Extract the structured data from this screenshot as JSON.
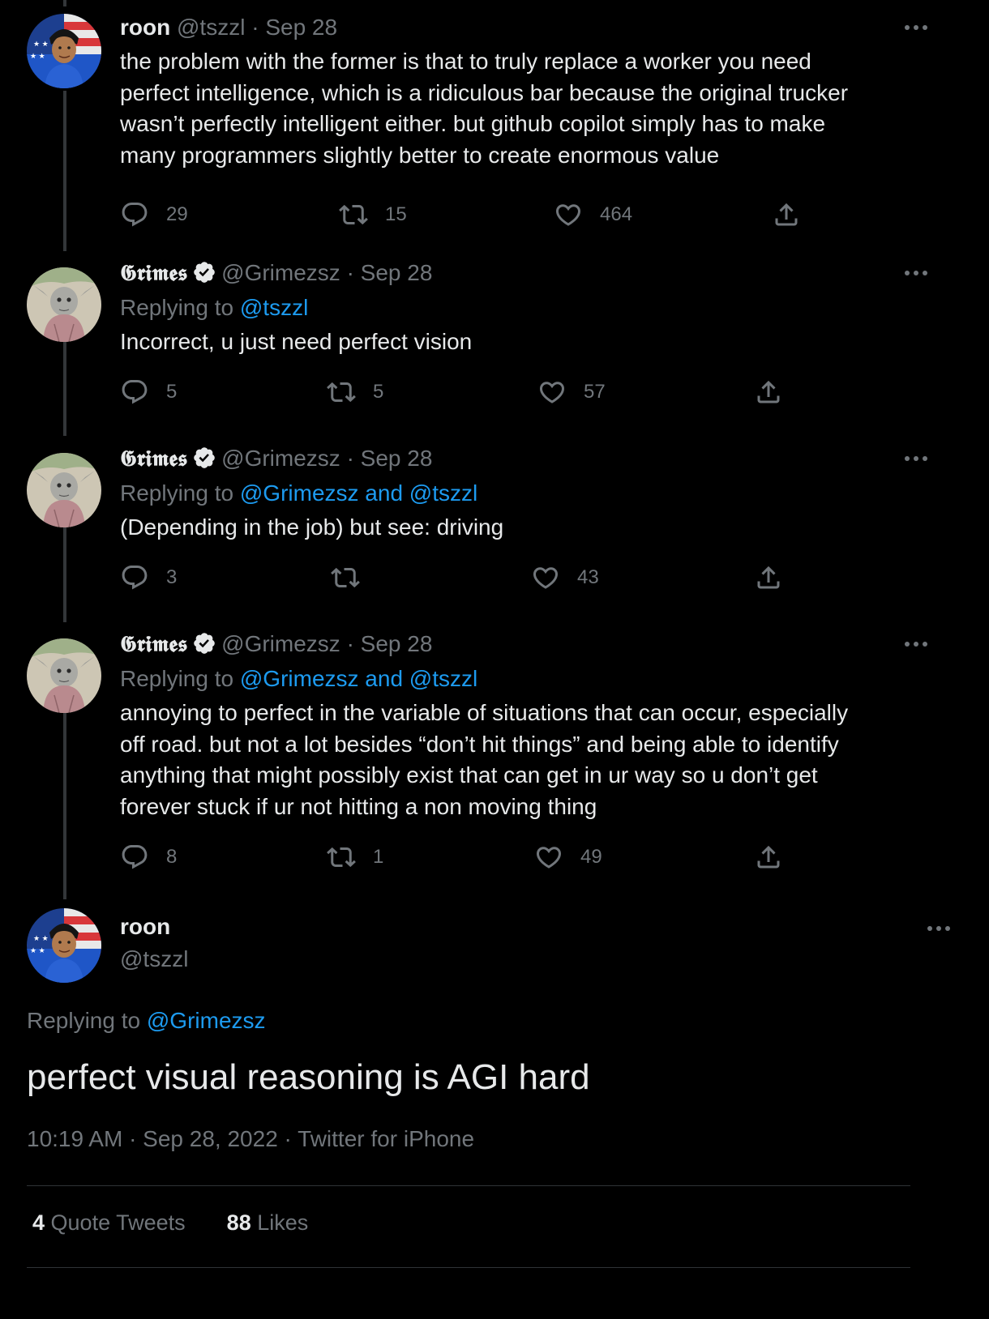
{
  "tweets": [
    {
      "display_name": "roon",
      "handle": "@tszzl",
      "date": "· Sep 28",
      "text_lines": [
        "the problem with the former is that to truly replace a worker you need",
        "perfect intelligence, which is a ridiculous bar because the original trucker",
        "wasn’t perfectly intelligent either. but github copilot simply has to make",
        "many programmers slightly better to create enormous value"
      ],
      "replies": "29",
      "retweets": "15",
      "likes": "464"
    },
    {
      "display_name": "𝕲𝖗𝖎𝖒𝖊𝖘",
      "handle": "@Grimezsz",
      "date": "· Sep 28",
      "replying_label": "Replying to ",
      "replying_to": "@tszzl",
      "text_lines": [
        "Incorrect, u just need perfect vision"
      ],
      "replies": "5",
      "retweets": "5",
      "likes": "57"
    },
    {
      "display_name": "𝕲𝖗𝖎𝖒𝖊𝖘",
      "handle": "@Grimezsz",
      "date": "· Sep 28",
      "replying_label": "Replying to ",
      "replying_to": "@Grimezsz and @tszzl",
      "text_lines": [
        "(Depending in the job) but see: driving"
      ],
      "replies": "3",
      "retweets": "",
      "likes": "43"
    },
    {
      "display_name": "𝕲𝖗𝖎𝖒𝖊𝖘",
      "handle": "@Grimezsz",
      "date": "· Sep 28",
      "replying_label": "Replying to ",
      "replying_to": "@Grimezsz and @tszzl",
      "text_lines": [
        "annoying to perfect in the variable of situations that can occur, especially",
        "off road. but not a lot besides “don’t hit things” and being able to identify",
        "anything that might possibly exist that can get in ur way so u don’t get",
        "forever stuck if ur not hitting a non moving thing"
      ],
      "replies": "8",
      "retweets": "1",
      "likes": "49"
    }
  ],
  "main_tweet": {
    "display_name": "roon",
    "handle": "@tszzl",
    "replying_label": "Replying to ",
    "replying_to": "@Grimezsz",
    "text": "perfect visual reasoning is AGI hard",
    "meta": "10:19 AM · Sep 28, 2022 · Twitter for iPhone",
    "quote_count": "4",
    "quote_label": " Quote Tweets",
    "likes_count": "88",
    "likes_label": " Likes"
  },
  "colors": {
    "background": "#000000",
    "text": "#e7e9ea",
    "secondary": "#71767b",
    "link": "#1d9bf0",
    "verified": "#e7e9ea"
  },
  "icons": [
    "reply-icon",
    "retweet-icon",
    "like-icon",
    "share-icon",
    "more-icon",
    "verified-icon"
  ]
}
